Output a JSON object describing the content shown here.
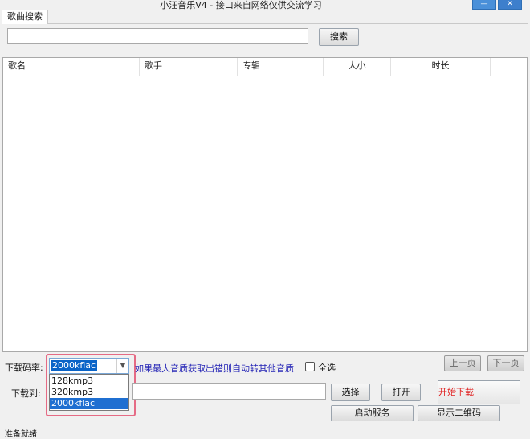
{
  "window": {
    "title": "小汪音乐V4 - 接口来自网络仅供交流学习",
    "minimize_glyph": "—",
    "close_glyph": "✕"
  },
  "search": {
    "tab_label": "歌曲搜索",
    "query_value": "",
    "button_label": "搜索"
  },
  "results": {
    "columns": [
      "歌名",
      "歌手",
      "专辑",
      "大小",
      "时长"
    ],
    "rows": []
  },
  "download": {
    "bitrate_label": "下载码率:",
    "bitrate_selected": "2000kflac",
    "bitrate_options": [
      "128kmp3",
      "320kmp3",
      "2000kflac"
    ],
    "hint": "如果最大音质获取出错则自动转其他音质",
    "select_all_label": "全选",
    "select_all_checked": false,
    "prev_page_label": "上一页",
    "next_page_label": "下一页",
    "save_to_label": "下载到:",
    "save_path": "",
    "choose_label": "选择",
    "open_label": "打开",
    "start_label": "开始下载",
    "start_service_label": "启动服务",
    "show_qr_label": "显示二维码"
  },
  "status": {
    "text": "准备就绪"
  },
  "colors": {
    "highlight_border": "#e56b85",
    "selection": "#1f6fd1",
    "hint_text": "#1f1fb4",
    "start_text": "#e02020",
    "window_button": "#4a90d9"
  },
  "icons": {
    "dropdown_arrow": "chevron-down-icon",
    "minimize": "minimize-icon",
    "close": "close-icon"
  }
}
